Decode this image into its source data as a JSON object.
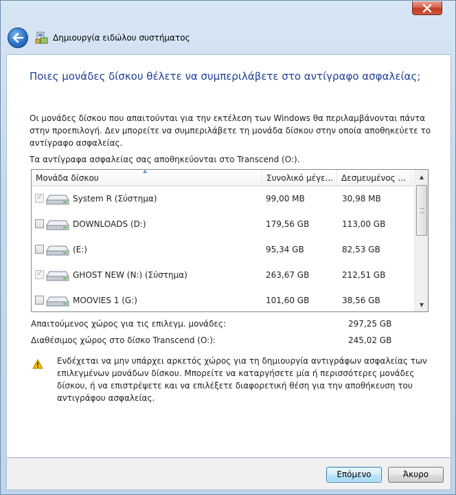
{
  "window": {
    "title": "Δημιουργία ειδώλου συστήματος"
  },
  "content": {
    "question": "Ποιες μονάδες δίσκου θέλετε να συμπεριλάβετε στο αντίγραφο ασφαλείας;",
    "info": "Οι μονάδες δίσκου που απαιτούνται για την εκτέλεση των Windows θα περιλαμβάνονται πάντα στην προεπιλογή. Δεν μπορείτε να συμπεριλάβετε τη μονάδα δίσκου στην οποία αποθηκεύετε το αντίγραφο ασφαλείας.",
    "stored_on": "Τα αντίγραφα ασφαλείας σας αποθηκεύονται στο Transcend (O:)."
  },
  "table": {
    "columns": [
      "Μονάδα δίσκου",
      "Συνολικό μέγε...",
      "Δεσμευμένος ..."
    ],
    "rows": [
      {
        "name": "System R (Σύστημα)",
        "total": "99,00 MB",
        "reserved": "30,98 MB",
        "checked": true,
        "disabled": true
      },
      {
        "name": "DOWNLOADS (D:)",
        "total": "179,56 GB",
        "reserved": "113,00 GB",
        "checked": false,
        "disabled": false
      },
      {
        "name": "(E:)",
        "total": "95,34 GB",
        "reserved": "82,53 GB",
        "checked": false,
        "disabled": false
      },
      {
        "name": "GHOST NEW (N:) (Σύστημα)",
        "total": "263,67 GB",
        "reserved": "212,51 GB",
        "checked": true,
        "disabled": true
      },
      {
        "name": "MOOVIES 1 (G:)",
        "total": "101,60 GB",
        "reserved": "38,56 GB",
        "checked": false,
        "disabled": false
      }
    ]
  },
  "space": {
    "required_label": "Απαιτούμενος χώρος για τις επιλεγμ. μονάδες:",
    "required_value": "297,25 GB",
    "available_label": "Διαθέσιμος χώρος στο δίσκο Transcend (O:):",
    "available_value": "245,02 GB"
  },
  "warning": {
    "text": "Ενδέχεται να μην υπάρχει αρκετός χώρος για τη δημιουργία αντιγράφων ασφαλείας των επιλεγμένων μονάδων δίσκου. Μπορείτε να καταργήσετε μία ή περισσότερες μονάδες δίσκου, ή να επιστρέψετε και να επιλέξετε διαφορετική θέση για την αποθήκευση του αντιγράφου ασφαλείας."
  },
  "buttons": {
    "next": "Επόμενο",
    "cancel": "Άκυρο"
  }
}
